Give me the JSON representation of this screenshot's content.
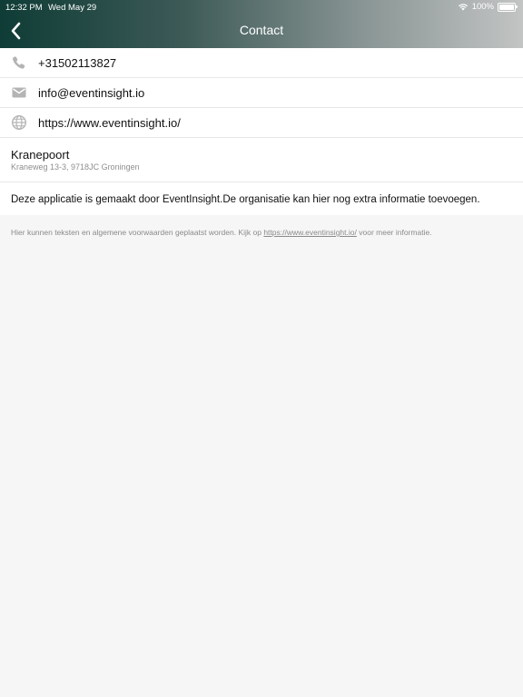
{
  "status_bar": {
    "time": "12:32 PM",
    "date": "Wed May 29",
    "battery": "100%"
  },
  "nav": {
    "title": "Contact",
    "back_icon": "chevron-left-icon"
  },
  "contact": {
    "phone": "+31502113827",
    "email": "info@eventinsight.io",
    "website": "https://www.eventinsight.io/"
  },
  "address": {
    "name": "Kranepoort",
    "street": "Kraneweg 13-3, 9718JC Groningen"
  },
  "about": {
    "text": "Deze applicatie is gemaakt door EventInsight.De organisatie kan hier nog extra informatie toevoegen."
  },
  "footer": {
    "prefix": "Hier kunnen teksten en algemene voorwaarden geplaatst worden. Kijk op",
    "link": "https://www.eventinsight.io/",
    "suffix": "voor meer informatie."
  },
  "colors": {
    "header_start": "#0f3c36",
    "header_end": "#c3c4c4",
    "background": "#f6f6f6"
  }
}
